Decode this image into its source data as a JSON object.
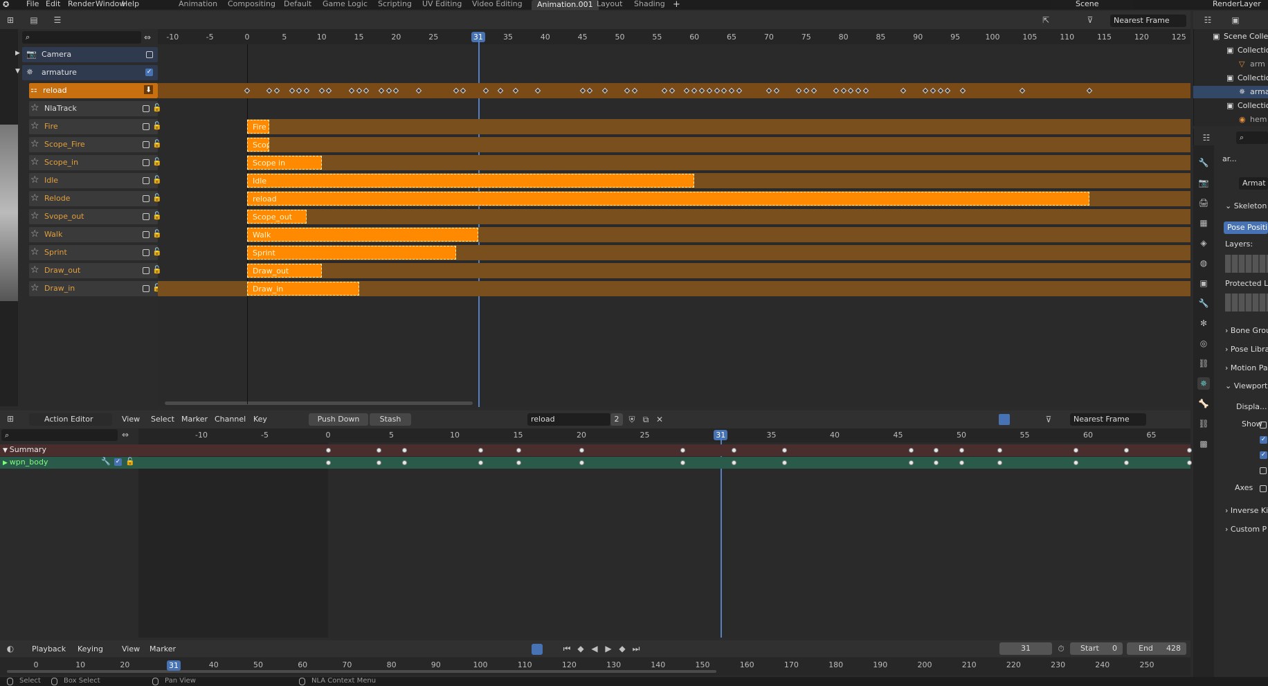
{
  "topbar": {
    "menus": [
      "File",
      "Edit",
      "Render",
      "Window",
      "Help"
    ],
    "workspaces": [
      "Animation",
      "Compositing",
      "Default",
      "Game Logic",
      "Scripting",
      "UV Editing",
      "Video Editing",
      "Animation.001",
      "Layout",
      "Shading"
    ],
    "active_workspace": "Animation.001",
    "scene": "Scene",
    "render_layer": "RenderLayer"
  },
  "nla": {
    "snapping": "Nearest Frame",
    "current_frame": "31",
    "ruler": [
      "-10",
      "-5",
      "0",
      "5",
      "10",
      "15",
      "20",
      "25",
      "30",
      "35",
      "40",
      "45",
      "50",
      "55",
      "60",
      "65",
      "70",
      "75",
      "80",
      "85",
      "90",
      "95",
      "100",
      "105",
      "110",
      "115",
      "120",
      "125"
    ],
    "channels": [
      {
        "name": "Camera",
        "type": "object"
      },
      {
        "name": "armature",
        "type": "object"
      },
      {
        "name": "reload",
        "type": "action"
      },
      {
        "name": "NlaTrack",
        "type": "track"
      },
      {
        "name": "Fire",
        "type": "track"
      },
      {
        "name": "Scope_Fire",
        "type": "track"
      },
      {
        "name": "Scope_in",
        "type": "track"
      },
      {
        "name": "Idle",
        "type": "track"
      },
      {
        "name": "Relode",
        "type": "track"
      },
      {
        "name": "Svope_out",
        "type": "track"
      },
      {
        "name": "Walk",
        "type": "track"
      },
      {
        "name": "Sprint",
        "type": "track"
      },
      {
        "name": "Draw_out",
        "type": "track"
      },
      {
        "name": "Draw_in",
        "type": "track"
      }
    ],
    "strips": [
      {
        "track": "Fire",
        "label": "Fire",
        "start": 0,
        "end": 3
      },
      {
        "track": "Scope_Fire",
        "label": "Scope",
        "start": 0,
        "end": 3
      },
      {
        "track": "Scope_in",
        "label": "Scope in",
        "start": 0,
        "end": 10
      },
      {
        "track": "Idle",
        "label": "Idle",
        "start": 0,
        "end": 60
      },
      {
        "track": "Relode",
        "label": "reload",
        "start": 0,
        "end": 113
      },
      {
        "track": "Svope_out",
        "label": "Scope_out",
        "start": 0,
        "end": 8
      },
      {
        "track": "Walk",
        "label": "Walk",
        "start": 0,
        "end": 31
      },
      {
        "track": "Sprint",
        "label": "Sprint",
        "start": 0,
        "end": 28
      },
      {
        "track": "Draw_out",
        "label": "Draw_out",
        "start": 0,
        "end": 10
      },
      {
        "track": "Draw_in",
        "label": "Draw_in",
        "start": 0,
        "end": 15
      }
    ],
    "reload_keys": [
      0,
      3,
      4,
      6,
      7,
      8,
      10,
      11,
      14,
      15,
      16,
      18,
      19,
      20,
      23,
      28,
      29,
      32,
      34,
      36,
      39,
      45,
      46,
      48,
      51,
      52,
      56,
      57,
      59,
      60,
      61,
      62,
      63,
      64,
      65,
      66,
      70,
      71,
      74,
      75,
      76,
      79,
      80,
      81,
      82,
      83,
      88,
      91,
      92,
      93,
      94,
      96,
      104,
      113
    ]
  },
  "action_editor": {
    "mode": "Action Editor",
    "menus": [
      "View",
      "Select",
      "Marker",
      "Channel",
      "Key"
    ],
    "push_down": "Push Down",
    "stash": "Stash",
    "action_name": "reload",
    "users": "2",
    "snapping": "Nearest Frame",
    "current_frame": "31",
    "ruler": [
      "-10",
      "-5",
      "0",
      "5",
      "10",
      "15",
      "20",
      "25",
      "30",
      "35",
      "40",
      "45",
      "50",
      "55",
      "60",
      "65"
    ],
    "channels": [
      "Summary",
      "wpn_body"
    ],
    "keys": [
      0,
      4,
      6,
      12,
      15,
      20,
      28,
      32,
      36,
      46,
      48,
      50,
      53,
      59,
      63,
      68
    ]
  },
  "timeline": {
    "menus": [
      "Playback",
      "Keying",
      "View",
      "Marker"
    ],
    "current_frame": "31",
    "start_label": "Start",
    "start": "0",
    "end_label": "End",
    "end": "428",
    "ruler": [
      "0",
      "10",
      "20",
      "30",
      "40",
      "50",
      "60",
      "70",
      "80",
      "90",
      "100",
      "110",
      "120",
      "130",
      "140",
      "150",
      "160",
      "170",
      "180",
      "190",
      "200",
      "210",
      "220",
      "230",
      "240",
      "250"
    ]
  },
  "statusbar": {
    "items": [
      "Select",
      "Box Select",
      "Pan View",
      "NLA Context Menu"
    ]
  },
  "outliner": {
    "items": [
      "Scene Collection",
      "Collection",
      "arm",
      "Collection",
      "arma",
      "Collection",
      "hem"
    ]
  },
  "properties": {
    "object": "ar...",
    "data_name": "Armat",
    "skeleton": "Skeleton",
    "pose_position": "Pose Positi...",
    "layers": "Layers:",
    "protected_layers": "Protected La",
    "panels": [
      "Bone Grou",
      "Pose Libra",
      "Motion Pa"
    ],
    "viewport": "Viewport",
    "display": "Displa...",
    "show": "Show",
    "axes": "Axes",
    "panels2": [
      "Inverse Ki",
      "Custom P"
    ]
  },
  "colors": {
    "accent": "#4772b3",
    "strip": "#ff8a00",
    "track_bg": "#7a4f1e",
    "selected_green": "#2a5a4a",
    "summary_bg": "#4a2e2e"
  }
}
